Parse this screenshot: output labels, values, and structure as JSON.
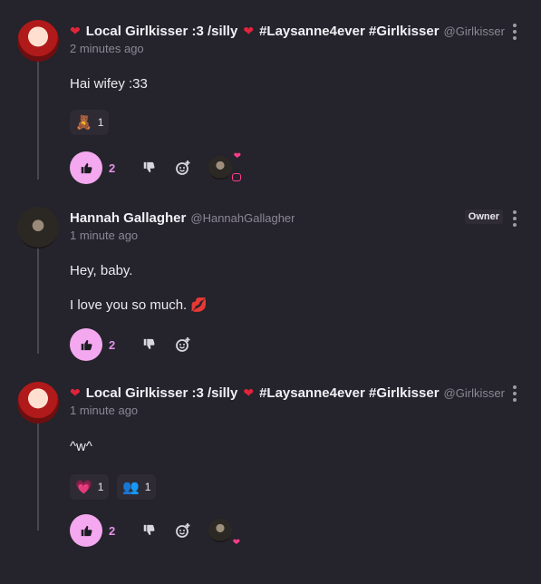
{
  "comments": [
    {
      "display_name": "Local Girlkisser :3 /silly",
      "hashtags": "#Laysanne4ever #Girlkisser",
      "handle": "@Girlkisser",
      "time": "2 minutes ago",
      "lines": [
        "Hai wifey :33"
      ],
      "reactions": [
        {
          "emoji": "🧸",
          "count": "1"
        }
      ],
      "likes": "2"
    },
    {
      "display_name": "Hannah Gallagher",
      "handle": "@HannahGallagher",
      "badge": "Owner",
      "time": "1 minute ago",
      "lines": [
        "Hey, baby.",
        "I love you so much. 💋"
      ],
      "likes": "2"
    },
    {
      "display_name": "Local Girlkisser :3 /silly",
      "hashtags": "#Laysanne4ever #Girlkisser",
      "handle": "@Girlkisser",
      "time": "1 minute ago",
      "lines": [
        "^w^"
      ],
      "reactions": [
        {
          "emoji": "💗",
          "count": "1"
        },
        {
          "emoji": "👥",
          "count": "1"
        }
      ],
      "likes": "2"
    }
  ],
  "colors": {
    "accent": "#f3a8ef",
    "like_count": "#e491e8",
    "background": "#25232b",
    "heart": "#e0243b"
  }
}
